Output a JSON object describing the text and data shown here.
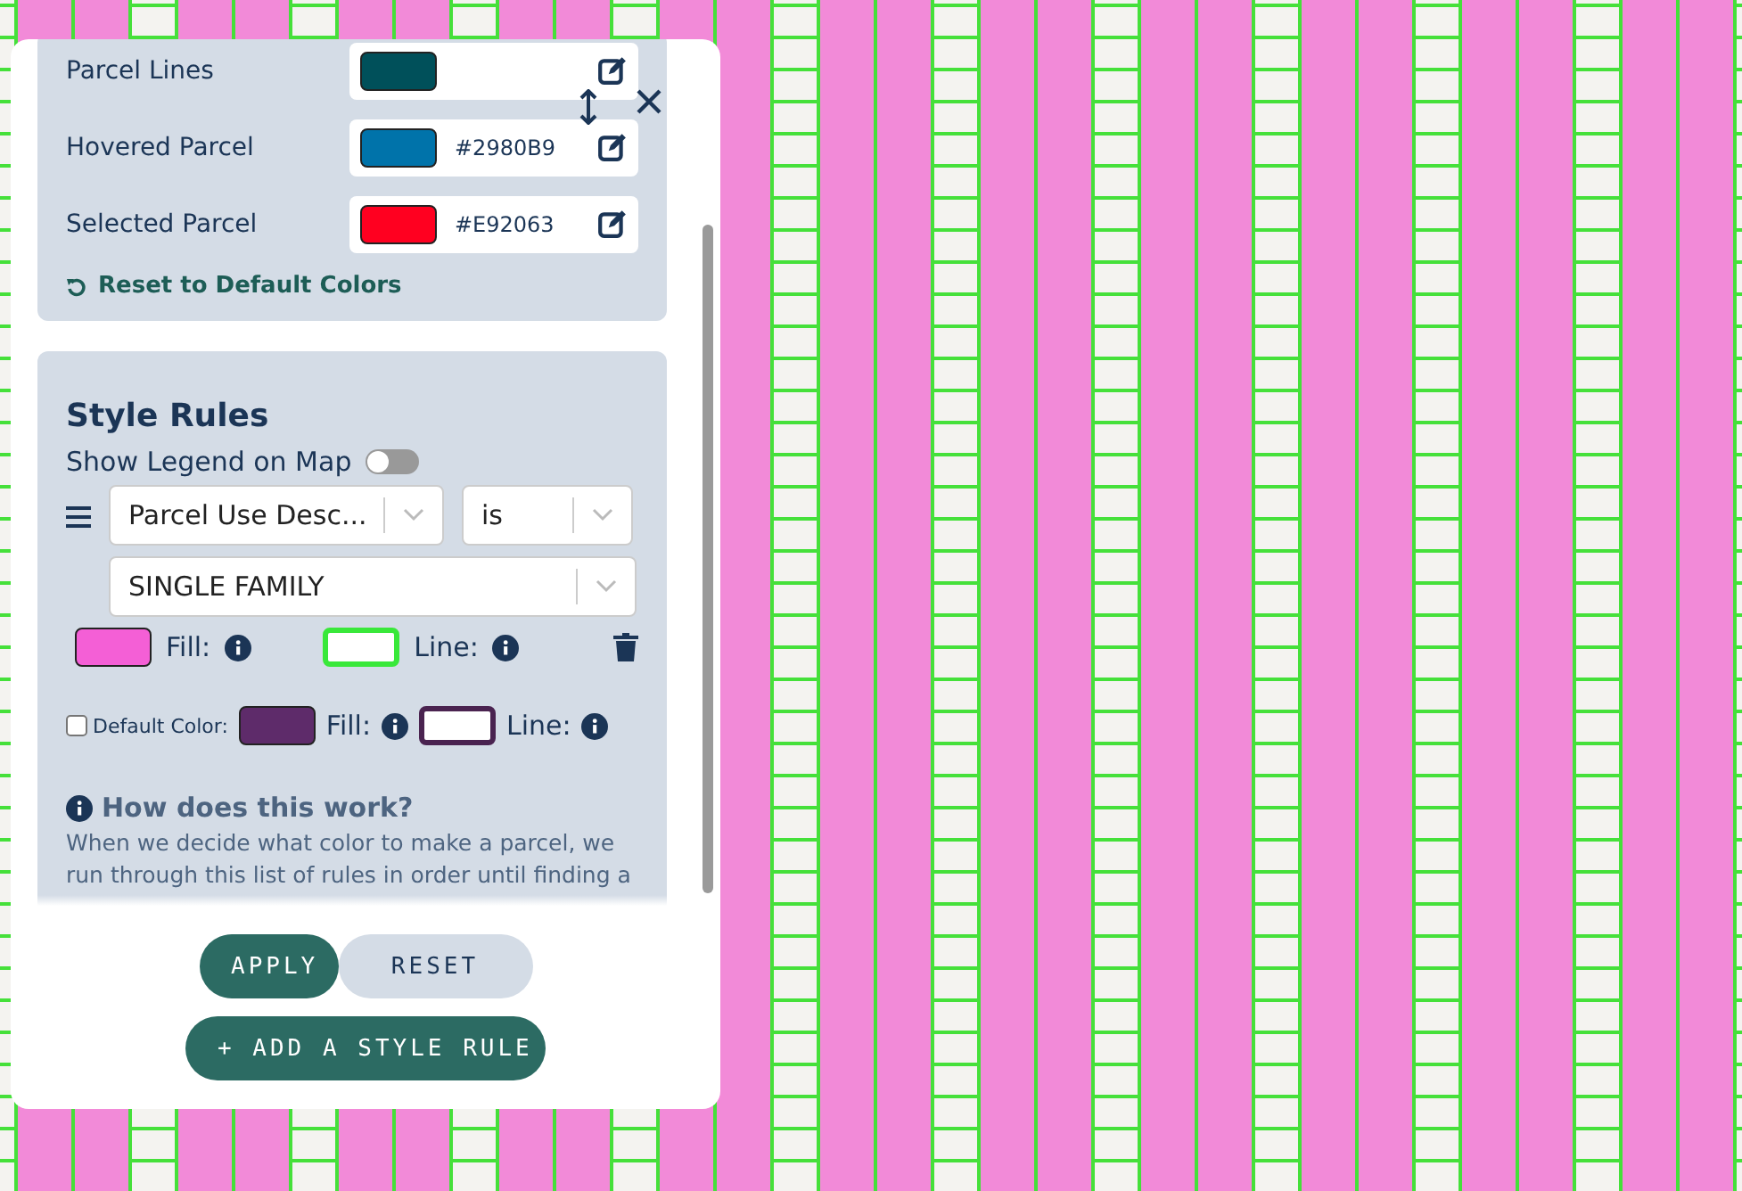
{
  "color_settings": [
    {
      "label": "Parcel Lines",
      "color": "#00505a"
    },
    {
      "label": "Hovered Parcel",
      "color": "#0073aa",
      "value": "#2980B9"
    },
    {
      "label": "Selected Parcel",
      "color": "#ff0020",
      "value": "#E92063"
    }
  ],
  "reset_colors": "Reset to Default Colors",
  "style_rules": {
    "title": "Style Rules",
    "show_legend": {
      "label": "Show Legend on Map",
      "on": false
    },
    "rules": [
      {
        "field": "Parcel Use Desc...",
        "operator": "is",
        "value": "SINGLE FAMILY",
        "fill": {
          "label": "Fill:",
          "color": "#f45fd6"
        },
        "line": {
          "label": "Line:",
          "color": "#39e83a"
        }
      }
    ],
    "default": {
      "checked": false,
      "label": "Default Color:",
      "fill": {
        "label": "Fill:",
        "color": "#5e2b6a"
      },
      "line": {
        "label": "Line:",
        "color": "#4a2350"
      }
    },
    "help": {
      "title": "How does this work?",
      "text": "When we decide what color to make a parcel, we run through this list of rules in order until finding a"
    }
  },
  "buttons": {
    "apply": "APPLY",
    "reset": "RESET",
    "add_rule": "+ ADD A STYLE RULE"
  }
}
